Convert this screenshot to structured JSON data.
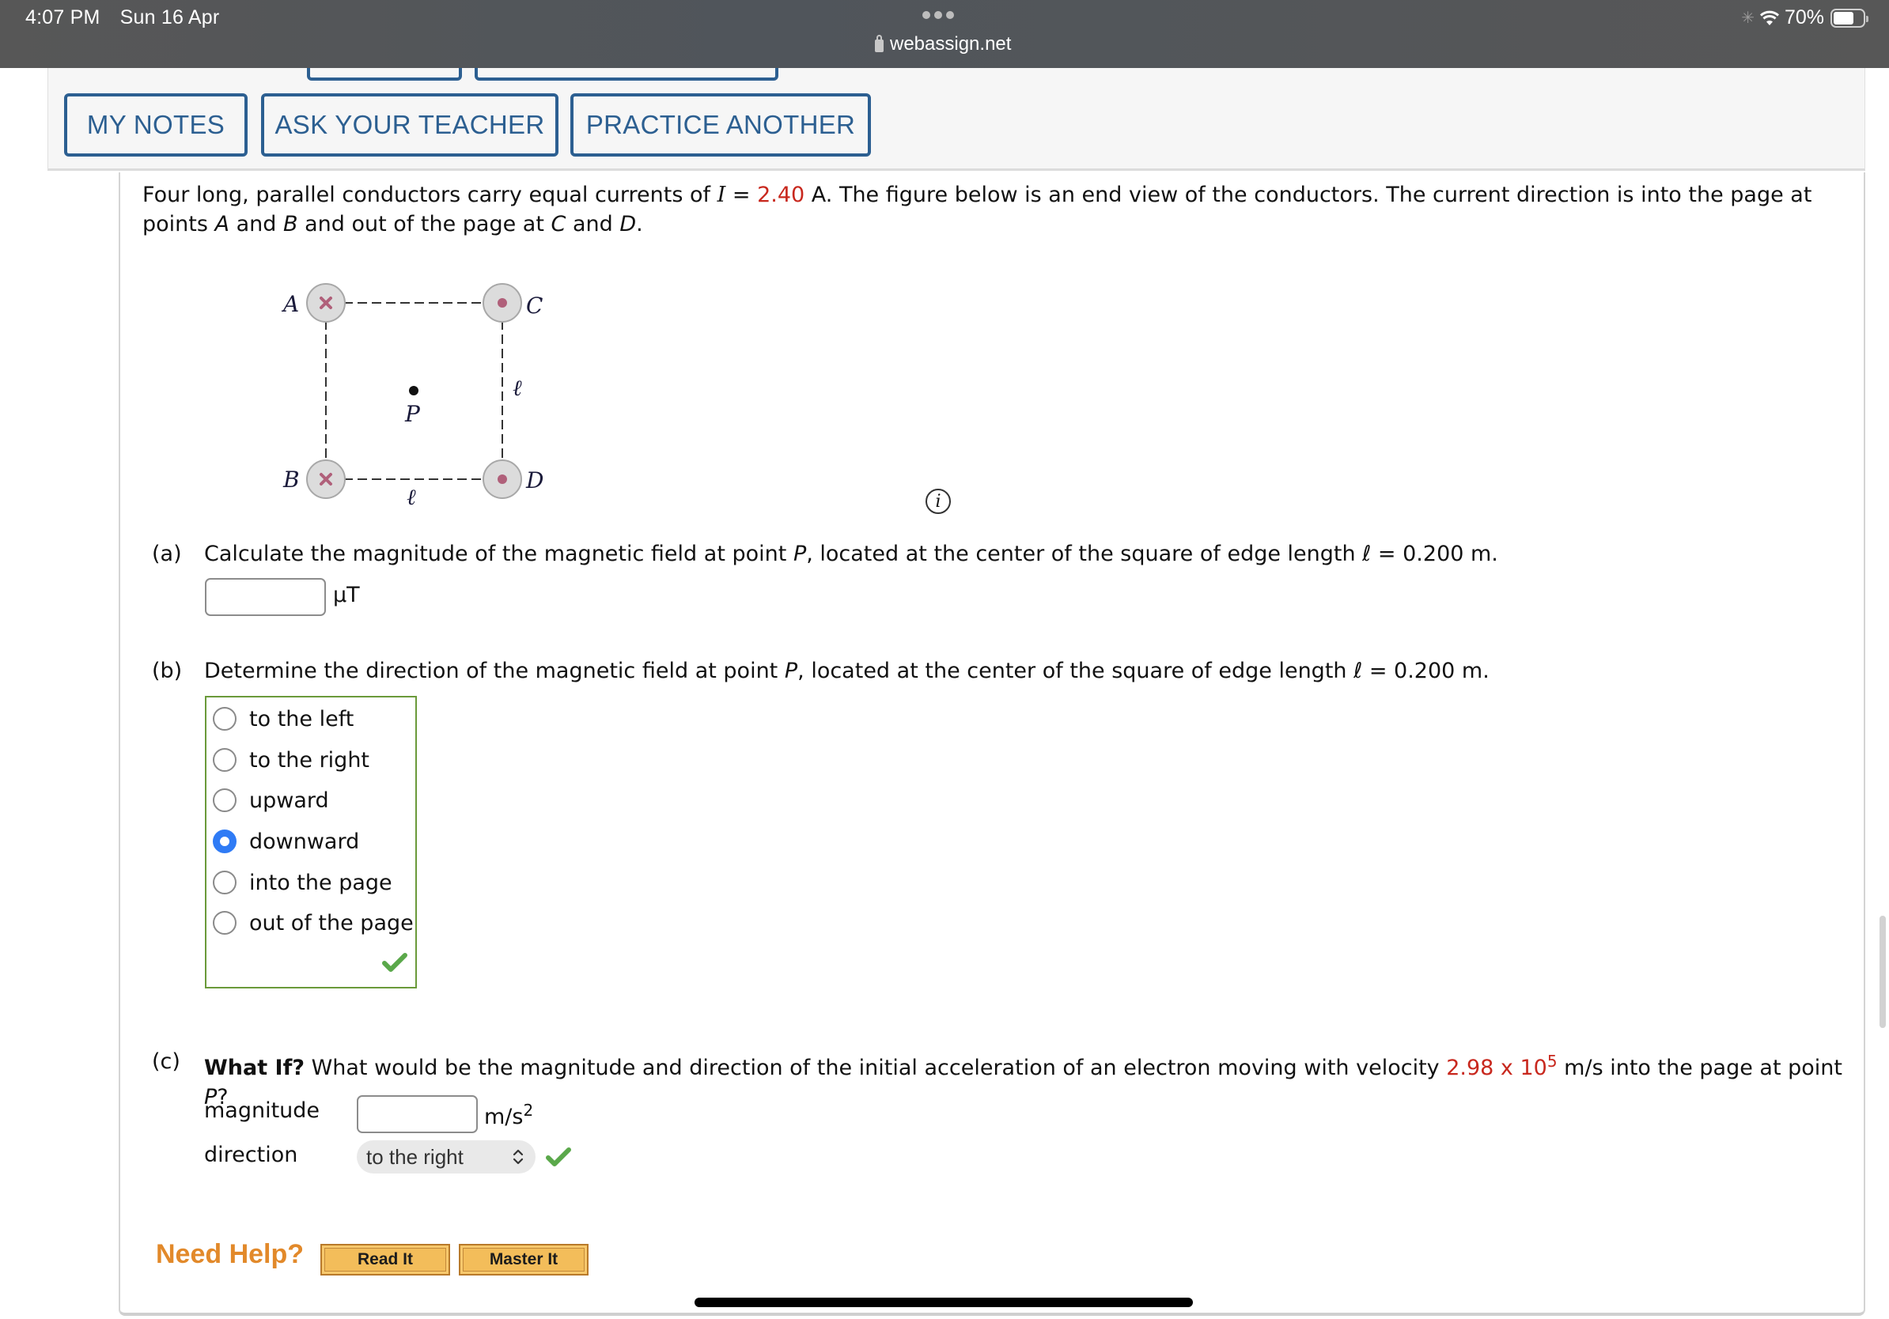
{
  "status_bar": {
    "time": "4:07 PM",
    "date": "Sun 16 Apr",
    "battery": "70%",
    "battery_level": 0.7,
    "url": "webassign.net",
    "icons": [
      "activity-spinner-icon",
      "wifi-icon",
      "battery-icon",
      "lock-icon",
      "tab-dots-icon"
    ]
  },
  "toolbar": {
    "my_notes": "MY NOTES",
    "ask_teacher": "ASK YOUR TEACHER",
    "practice_another": "PRACTICE ANOTHER"
  },
  "problem": {
    "intro_1": "Four long, parallel conductors carry equal currents of ",
    "intro_var": "I",
    "intro_eq": " = ",
    "current_value": "2.40",
    "intro_2": " A. The figure below is an end view of the conductors. The current direction is into the page at points ",
    "intro_A": "A",
    "intro_and1": " and ",
    "intro_B": "B",
    "intro_3": " and out of the page at ",
    "intro_C": "C",
    "intro_and2": " and ",
    "intro_D": "D",
    "intro_end": "."
  },
  "figure": {
    "labels": {
      "a": "A",
      "b": "B",
      "c": "C",
      "d": "D",
      "p": "P",
      "edge_right": "ℓ",
      "edge_bottom": "ℓ"
    },
    "conductors": [
      {
        "name": "A",
        "direction": "into-page"
      },
      {
        "name": "B",
        "direction": "into-page"
      },
      {
        "name": "C",
        "direction": "out-of-page"
      },
      {
        "name": "D",
        "direction": "out-of-page"
      }
    ],
    "colors": {
      "conductor_fill": "#dcdcdc",
      "conductor_mark": "#b0607a"
    }
  },
  "part_a": {
    "label": "(a)",
    "text_1": "Calculate the magnitude of the magnetic field at point ",
    "var_p": "P",
    "text_2": ", located at the center of the square of edge length ℓ = 0.200 m.",
    "answer_value": "",
    "unit": "μT"
  },
  "part_b": {
    "label": "(b)",
    "text_1": "Determine the direction of the magnetic field at point ",
    "var_p": "P",
    "text_2": ", located at the center of the square of edge length ℓ = 0.200 m.",
    "options": [
      "to the left",
      "to the right",
      "upward",
      "downward",
      "into the page",
      "out of the page"
    ],
    "selected": "downward",
    "status": "correct"
  },
  "part_c": {
    "label": "(c)",
    "bold": "What If?",
    "text_1": " What would be the magnitude and direction of the initial acceleration of an electron moving with velocity ",
    "velocity_mantissa": "2.98 x 10",
    "velocity_exp": "5",
    "text_2": " m/s into the page at point ",
    "var_p": "P",
    "text_3": "?",
    "magnitude_label": "magnitude",
    "magnitude_value": "",
    "magnitude_unit": "m/s",
    "magnitude_unit_exp": "2",
    "direction_label": "direction",
    "direction_selected": "to the right",
    "direction_status": "correct"
  },
  "help": {
    "label": "Need Help?",
    "read_it": "Read It",
    "master_it": "Master It"
  },
  "colors": {
    "accent_blue": "#2c5f91",
    "value_red": "#c8281e",
    "radio_selected": "#2f7bf5",
    "correct_green": "#5aa84a",
    "help_orange": "#e2892a"
  }
}
